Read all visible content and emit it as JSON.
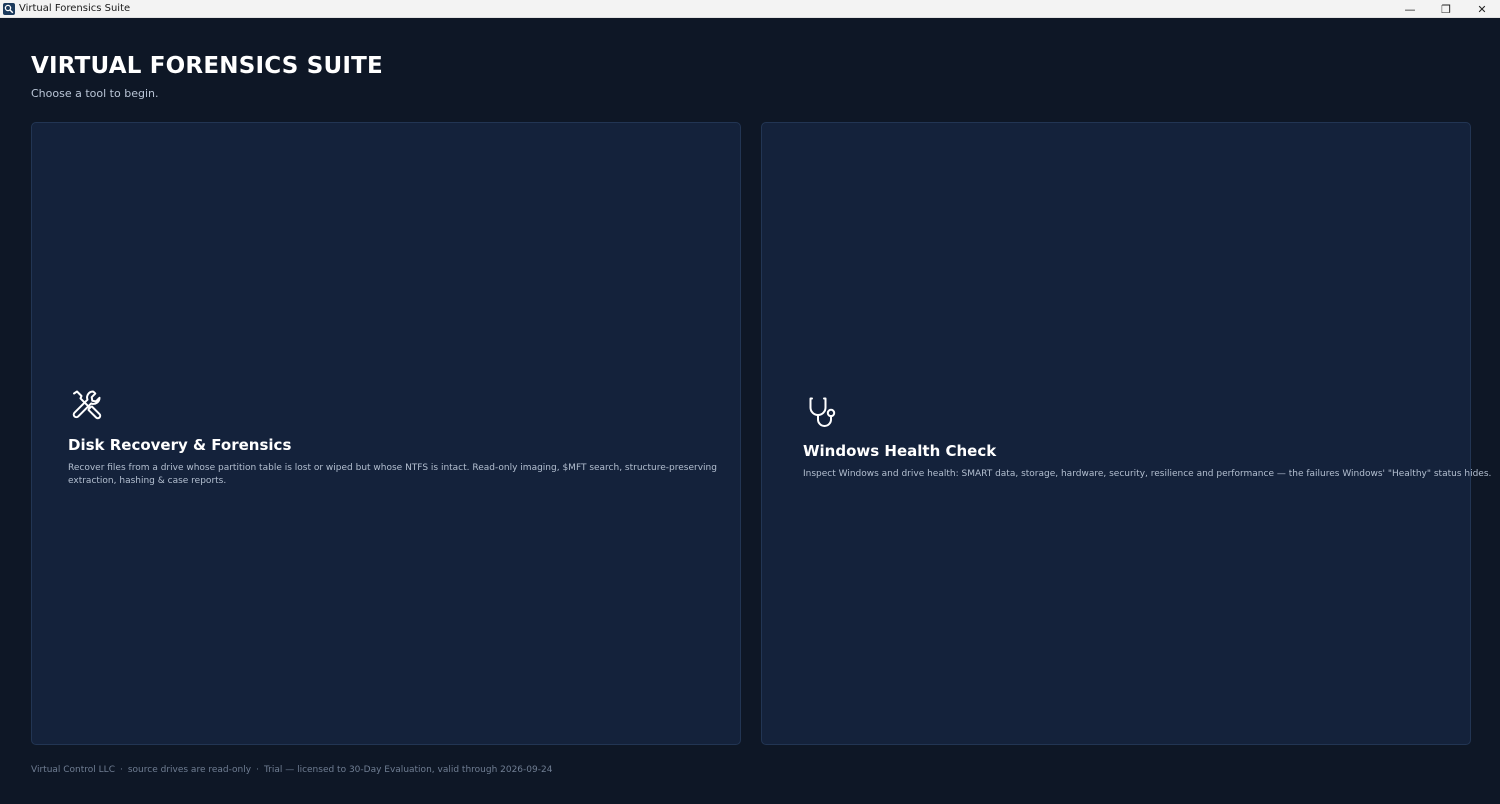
{
  "window": {
    "title": "Virtual Forensics Suite",
    "controls": {
      "minimize": "—",
      "restore": "❐",
      "close": "✕"
    }
  },
  "header": {
    "title": "VIRTUAL FORENSICS SUITE",
    "subtitle": "Choose a tool to begin."
  },
  "tools": [
    {
      "icon": "tools-icon",
      "title": "Disk Recovery & Forensics",
      "description": "Recover files from a drive whose partition table is lost or wiped but whose NTFS is intact. Read-only imaging, $MFT search, structure-preserving extraction, hashing & case reports."
    },
    {
      "icon": "stethoscope-icon",
      "title": "Windows Health Check",
      "description": "Inspect Windows and drive health: SMART data, storage, hardware, security, resilience and performance — the failures Windows' \"Healthy\" status hides."
    }
  ],
  "footer": {
    "company": "Virtual Control LLC",
    "sep1": "·",
    "readonly_note": "source drives are read-only",
    "sep2": "·",
    "license": "Trial — licensed to 30-Day Evaluation, valid through 2026-09-24"
  },
  "colors": {
    "background": "#0e1726",
    "card": "#14223b",
    "card_border": "#223553",
    "title": "#ffffff",
    "muted": "#b3bfd0"
  }
}
